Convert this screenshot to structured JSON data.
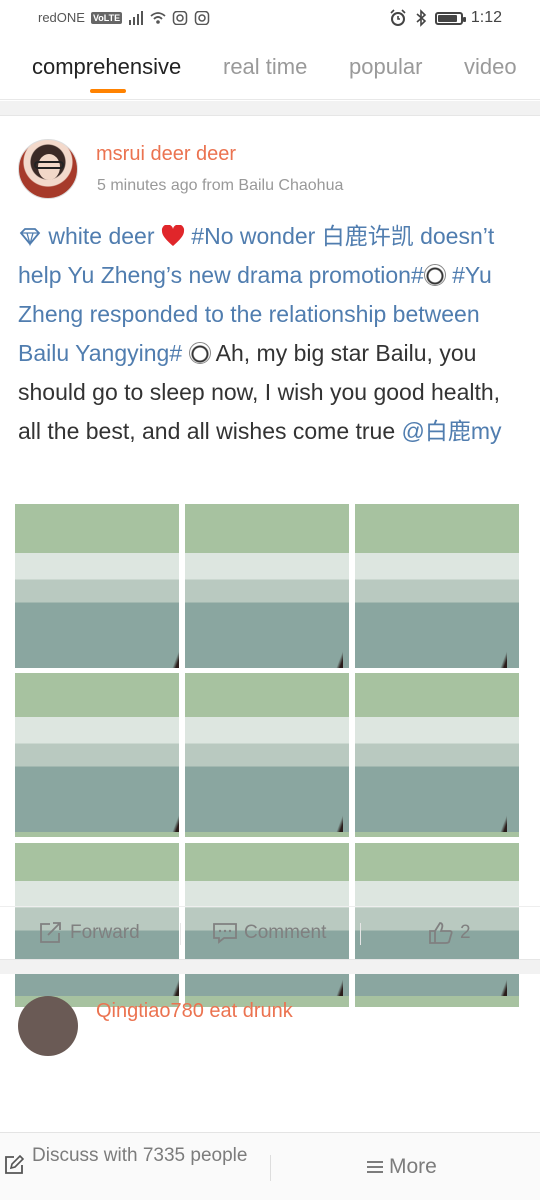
{
  "status_bar": {
    "carrier": "redONE",
    "volte": "VoLTE",
    "time": "1:12",
    "battery_level": 0.85
  },
  "tabs": [
    {
      "label": "comprehensive",
      "active": true
    },
    {
      "label": "real time",
      "active": false
    },
    {
      "label": "popular",
      "active": false
    },
    {
      "label": "video",
      "active": false
    }
  ],
  "post": {
    "username": "msrui deer deer",
    "meta": "5 minutes ago from Bailu Chaohua",
    "text": {
      "t1": "white deer",
      "t2": "#No wonder 白鹿许凯 doesn’t help Yu Zheng’s new drama promotion#",
      "t3": "#Yu Zheng responded to the relationship between Bailu Yangying#",
      "t4": "Ah, my big star Bailu, you should go to sleep now, I wish you good health, all the best, and all wishes come true",
      "t5": "@白鹿my"
    },
    "actions": {
      "forward": "Forward",
      "comment": "Comment",
      "likes": "2"
    }
  },
  "next_post": {
    "username": "Qingtiao780 eat drunk"
  },
  "bottom_bar": {
    "discuss": "Discuss with 7335 people",
    "more": "More"
  },
  "colors": {
    "accent": "#ff8200",
    "username": "#eb7350",
    "link": "#507daf"
  }
}
